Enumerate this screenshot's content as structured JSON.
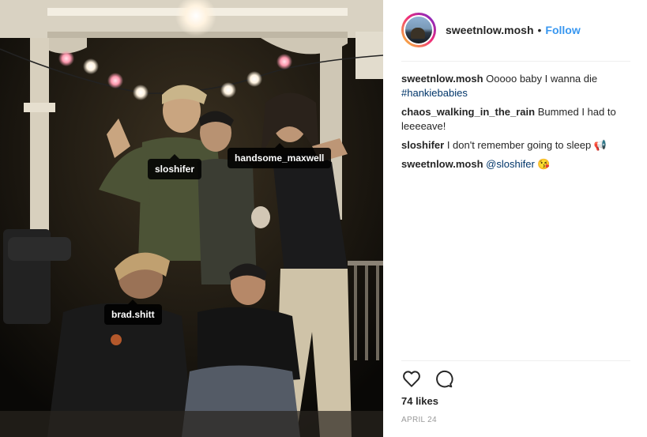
{
  "post": {
    "author": "sweetnlow.mosh",
    "separator": "•",
    "follow_label": "Follow",
    "likes": "74 likes",
    "date": "APRIL 24"
  },
  "tags": [
    {
      "label": "sloshifer"
    },
    {
      "label": "handsome_maxwell"
    },
    {
      "label": "brad.shitt"
    }
  ],
  "comments": [
    {
      "user": "sweetnlow.mosh",
      "text": "Ooooo baby I wanna die",
      "hashtag": "#hankiebabies"
    },
    {
      "user": "chaos_walking_in_the_rain",
      "text": "Bummed I had to leeeeave!"
    },
    {
      "user": "sloshifer",
      "text": "I don't remember going to sleep",
      "emoji": "👎"
    },
    {
      "user": "sweetnlow.mosh",
      "mention": "@sloshifer",
      "emoji": "😘"
    }
  ],
  "icons": {
    "like": "heart-icon",
    "comment": "comment-bubble-icon"
  },
  "colors": {
    "link_blue": "#3897f0",
    "hashtag_blue": "#003569",
    "text": "#262626",
    "muted": "#999999",
    "tag_background": "#000000"
  }
}
